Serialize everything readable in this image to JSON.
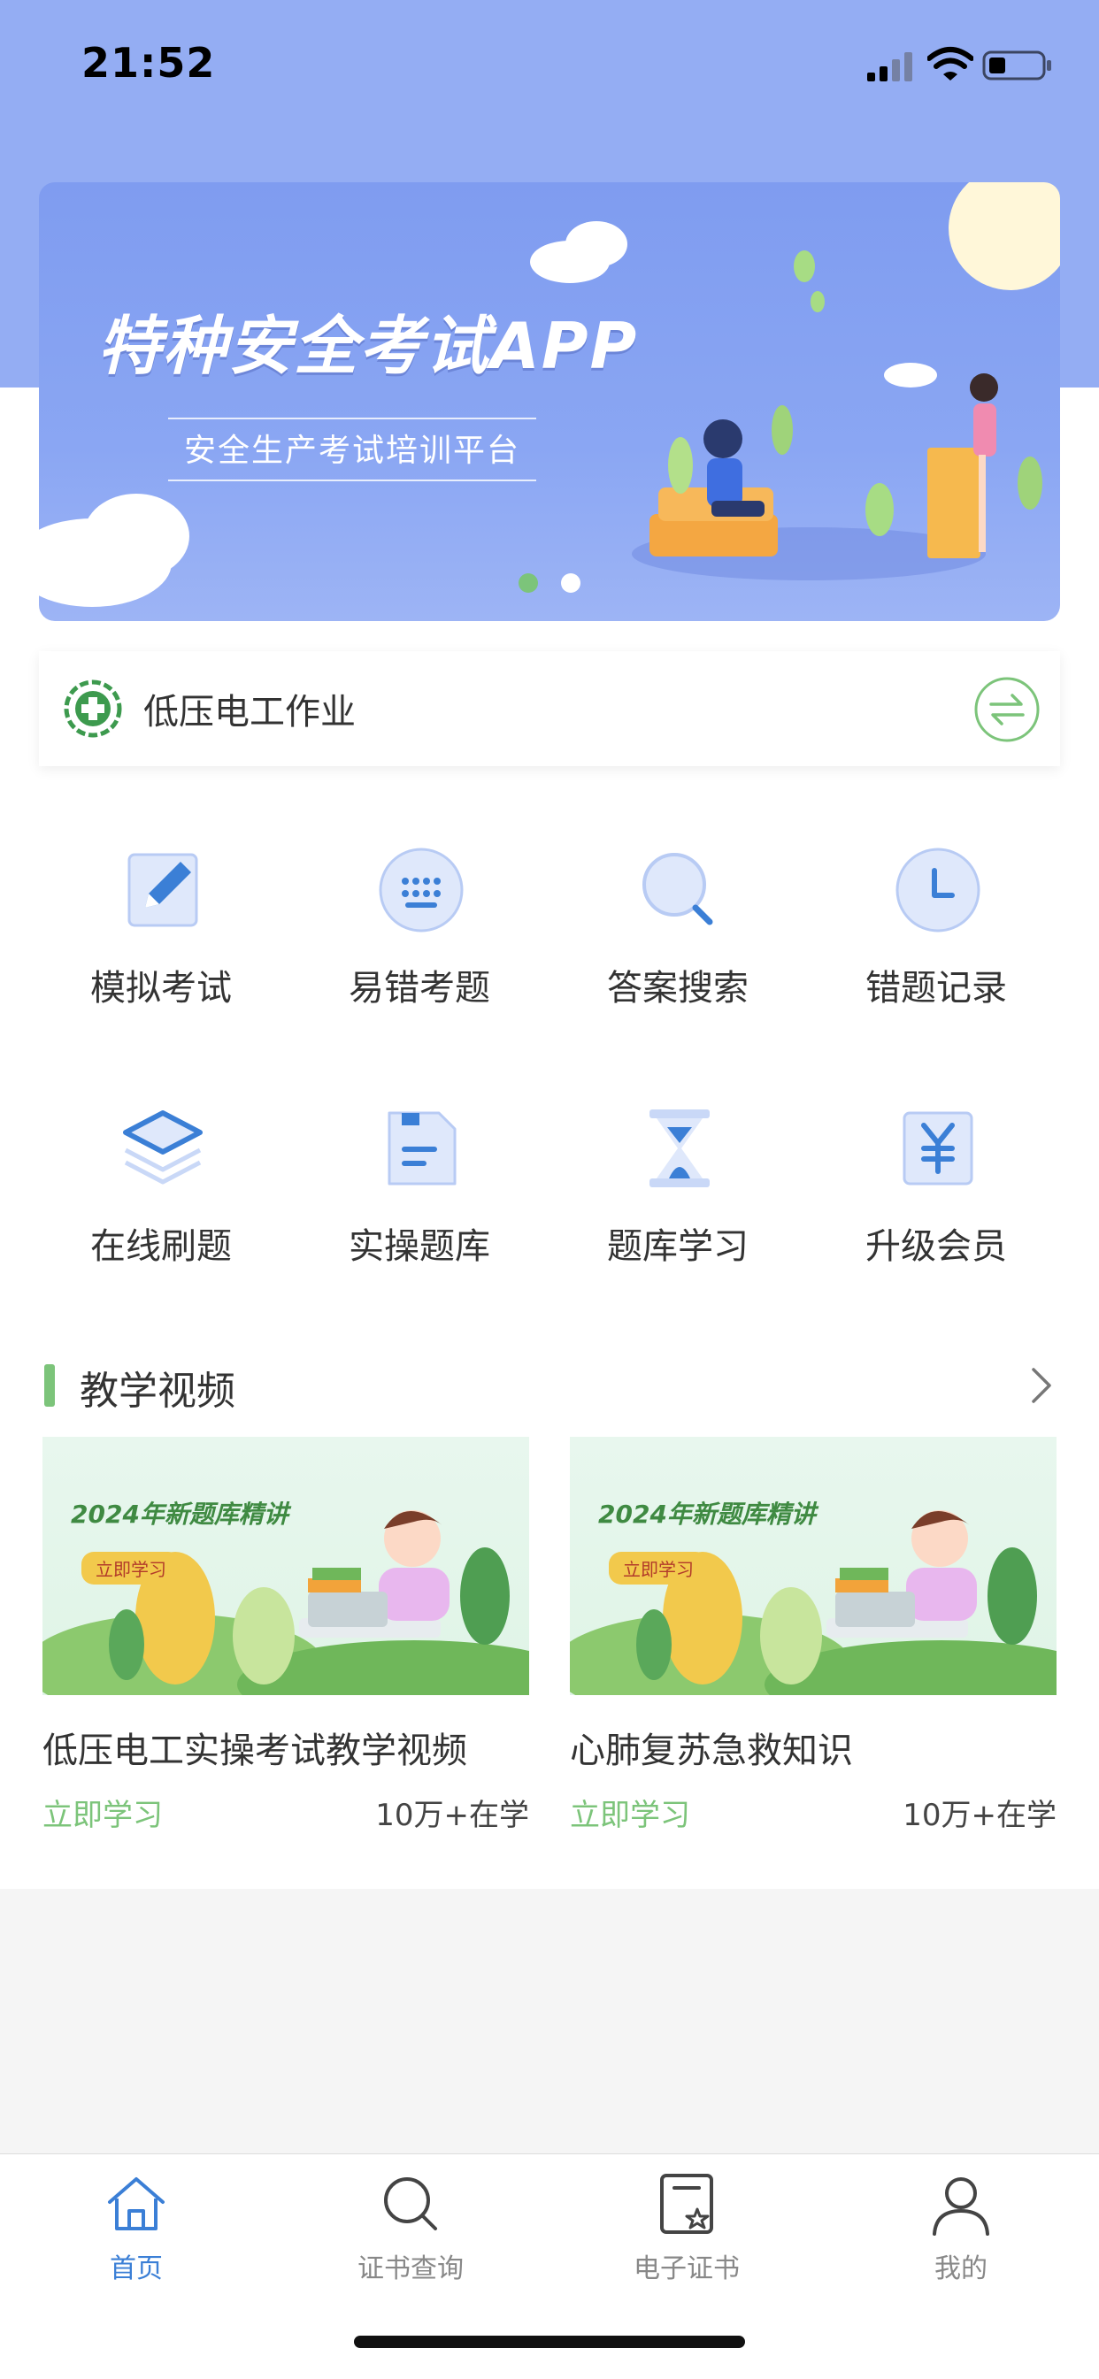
{
  "status_bar": {
    "time": "21:52"
  },
  "banner": {
    "title": "特种安全考试APP",
    "subtitle": "安全生产考试培训平台",
    "active_dot_color": "#7cc47a"
  },
  "category": {
    "name": "低压电工作业",
    "logo_icon": "safety-cross-icon",
    "switch_icon": "switch-icon"
  },
  "features": [
    {
      "label": "模拟考试",
      "icon": "edit-icon"
    },
    {
      "label": "易错考题",
      "icon": "keyboard-icon"
    },
    {
      "label": "答案搜索",
      "icon": "search-icon"
    },
    {
      "label": "错题记录",
      "icon": "clock-icon"
    },
    {
      "label": "在线刷题",
      "icon": "layers-icon"
    },
    {
      "label": "实操题库",
      "icon": "document-icon"
    },
    {
      "label": "题库学习",
      "icon": "hourglass-icon"
    },
    {
      "label": "升级会员",
      "icon": "yen-icon"
    }
  ],
  "section": {
    "title": "教学视频"
  },
  "videos": [
    {
      "thumb_heading": "2024年新题库精讲",
      "thumb_button": "立即学习",
      "title": "低压电工实操考试教学视频",
      "action": "立即学习",
      "count": "10万+在学"
    },
    {
      "thumb_heading": "2024年新题库精讲",
      "thumb_button": "立即学习",
      "title": "心肺复苏急救知识",
      "action": "立即学习",
      "count": "10万+在学"
    }
  ],
  "nav": [
    {
      "label": "首页",
      "icon": "home-icon",
      "active": true
    },
    {
      "label": "证书查询",
      "icon": "search-icon",
      "active": false
    },
    {
      "label": "电子证书",
      "icon": "certificate-icon",
      "active": false
    },
    {
      "label": "我的",
      "icon": "user-icon",
      "active": false
    }
  ],
  "colors": {
    "accent_blue": "#3b7fd6",
    "accent_green": "#7cc47a",
    "header_bg": "#94adf3"
  }
}
